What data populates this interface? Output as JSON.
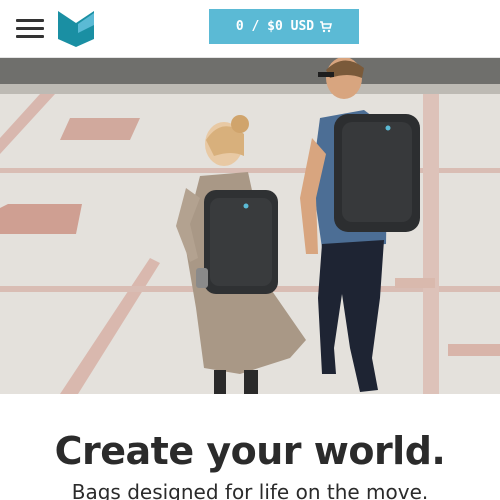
{
  "header": {
    "cart_label": "0 / $0 USD",
    "menu_icon": "hamburger-menu-icon",
    "logo_icon": "brand-logo-icon",
    "cart_icon": "shopping-cart-icon",
    "accent_color": "#5bbad5",
    "logo_colors": [
      "#1a8fa3",
      "#5bbad5"
    ]
  },
  "hero": {
    "image_description": "two people walking on a tiled plaza wearing black backpacks"
  },
  "content": {
    "headline": "Create your world.",
    "subheadline": "Bags designed for life on the move."
  }
}
